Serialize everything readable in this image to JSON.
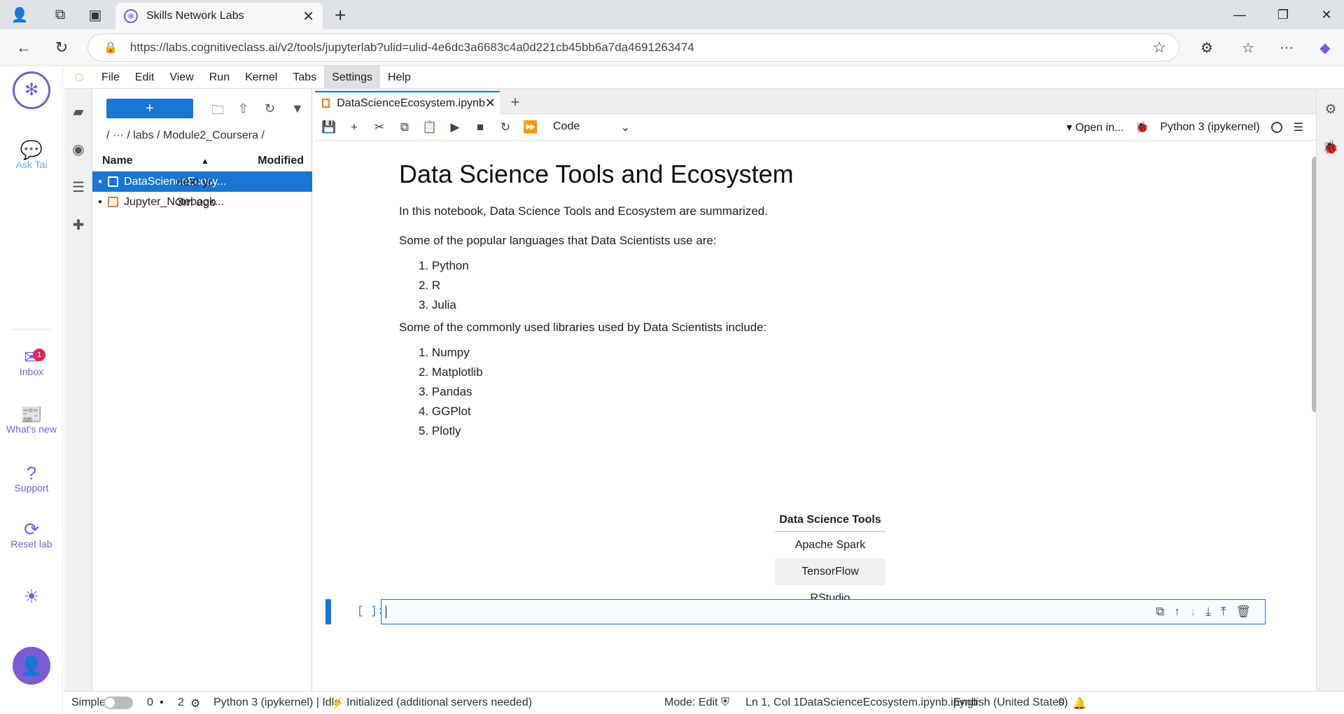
{
  "browser": {
    "tab_title": "Skills Network Labs",
    "url": "https://labs.cognitiveclass.ai/v2/tools/jupyterlab?ulid=ulid-4e6dc3a6683c4a0d221cb45bb6a7da4691263474"
  },
  "rail": {
    "ask": "Ask Tai",
    "inbox": "Inbox",
    "inbox_count": "1",
    "whats_new": "What's new",
    "support": "Support",
    "reset": "Reset lab"
  },
  "menu": [
    "File",
    "Edit",
    "View",
    "Run",
    "Kernel",
    "Tabs",
    "Settings",
    "Help"
  ],
  "filebrowser": {
    "breadcrumb": "/   ···  / labs / Module2_Coursera /",
    "col_name": "Name",
    "col_modified": "Modified",
    "files": [
      {
        "name": "DataScienceEcosy...",
        "modified": "next yr."
      },
      {
        "name": "Jupyter_Notebook...",
        "modified": "3m ago"
      }
    ]
  },
  "notebook": {
    "tab": "DataScienceEcosystem.ipynb",
    "cell_type": "Code",
    "open_in": "Open in...",
    "kernel": "Python 3 (ipykernel)",
    "title": "Data Science Tools and Ecosystem",
    "intro": "In this notebook, Data Science Tools and Ecosystem are summarized.",
    "lang_intro": "Some of the popular languages that Data Scientists use are:",
    "languages": [
      "1. Python",
      "2. R",
      "3. Julia"
    ],
    "lib_intro": "Some of the commonly used libraries used by Data Scientists include:",
    "libraries": [
      "1. Numpy",
      "2. Matplotlib",
      "3. Pandas",
      "4. GGPlot",
      "5. Plotly"
    ],
    "table_header": "Data Science Tools",
    "tools": [
      "Apache Spark",
      "TensorFlow",
      "RStudio"
    ],
    "prompt": "[ ]:"
  },
  "status": {
    "mode_label": "Simple",
    "terminals": "0",
    "kernels": "2",
    "kernel_status": "Python 3 (ipykernel) | Idle",
    "init": "Initialized (additional servers needed)",
    "mode": "Mode: Edit",
    "position": "Ln 1, Col 1",
    "file": "DataScienceEcosystem.ipynb.ipynb",
    "language": "English (United States)",
    "notifications": "0"
  }
}
